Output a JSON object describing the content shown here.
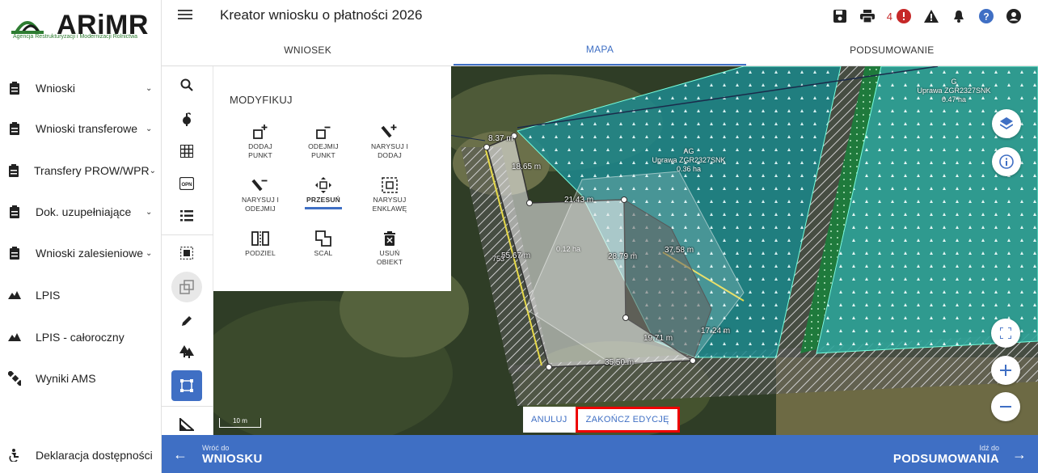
{
  "app": {
    "title": "Kreator wniosku o płatności 2026",
    "logo_text": "ARiMR",
    "logo_subtitle": "Agencja Restrukturyzacji i Modernizacji Rolnictwa",
    "notification_count": "4"
  },
  "sidebar": {
    "items": [
      {
        "label": "Wnioski",
        "icon": "clipboard-icon",
        "has_chevron": true
      },
      {
        "label": "Wnioski transferowe",
        "icon": "clipboard-icon",
        "has_chevron": true
      },
      {
        "label": "Transfery PROW/WPR",
        "icon": "clipboard-icon",
        "has_chevron": true
      },
      {
        "label": "Dok. uzupełniające",
        "icon": "clipboard-icon",
        "has_chevron": true
      },
      {
        "label": "Wnioski zalesieniowe",
        "icon": "clipboard-icon",
        "has_chevron": true
      },
      {
        "label": "LPIS",
        "icon": "terrain-icon",
        "has_chevron": false
      },
      {
        "label": "LPIS - całoroczny",
        "icon": "terrain-icon",
        "has_chevron": false
      },
      {
        "label": "Wyniki AMS",
        "icon": "satellite-icon",
        "has_chevron": false
      }
    ],
    "accessibility": "Deklaracja dostępności"
  },
  "tabs": [
    {
      "label": "WNIOSEK",
      "active": false
    },
    {
      "label": "MAPA",
      "active": true
    },
    {
      "label": "PODSUMOWANIE",
      "active": false
    }
  ],
  "modify_panel": {
    "title": "MODYFIKUJ",
    "tools": [
      {
        "label_1": "DODAJ",
        "label_2": "PUNKT"
      },
      {
        "label_1": "ODEJMIJ",
        "label_2": "PUNKT"
      },
      {
        "label_1": "NARYSUJ I",
        "label_2": "DODAJ"
      },
      {
        "label_1": "NARYSUJ I",
        "label_2": "ODEJMIJ"
      },
      {
        "label_1": "PRZESUŃ",
        "label_2": ""
      },
      {
        "label_1": "NARYSUJ",
        "label_2": "ENKLAWĘ"
      },
      {
        "label_1": "PODZIEL",
        "label_2": ""
      },
      {
        "label_1": "SCAL",
        "label_2": ""
      },
      {
        "label_1": "USUŃ",
        "label_2": "OBIEKT"
      }
    ],
    "selected": "PRZESUŃ"
  },
  "map": {
    "measurements": [
      "8.37 m",
      "18.65 m",
      "21.43 m",
      "55.67 m",
      "28.79 m",
      "37.58 m",
      "17.24 m",
      "19.71 m",
      "35.50 m"
    ],
    "parcel_label_1": "AG",
    "parcel_label_2": "Uprawa ZGR2327SNK",
    "parcel_area": "0.36 ha",
    "parcel_g_label": "G",
    "parcel_g_crop": "Uprawa ZGR2327SNK",
    "parcel_g_area": "0.47 ha",
    "polygon_area": "0.12 ha",
    "edge_label": "753",
    "scale": "10 m"
  },
  "actions": {
    "cancel": "ANULUJ",
    "finish": "ZAKOŃCZ EDYCJĘ"
  },
  "bottom": {
    "back_small": "Wróć do",
    "back_large": "WNIOSKU",
    "next_small": "Idź do",
    "next_large": "PODSUMOWANIA"
  },
  "colors": {
    "accent": "#3f6fc4",
    "danger": "#c62828",
    "parcel_fill": "#1f8a8a",
    "highlight": "#ff0000"
  }
}
